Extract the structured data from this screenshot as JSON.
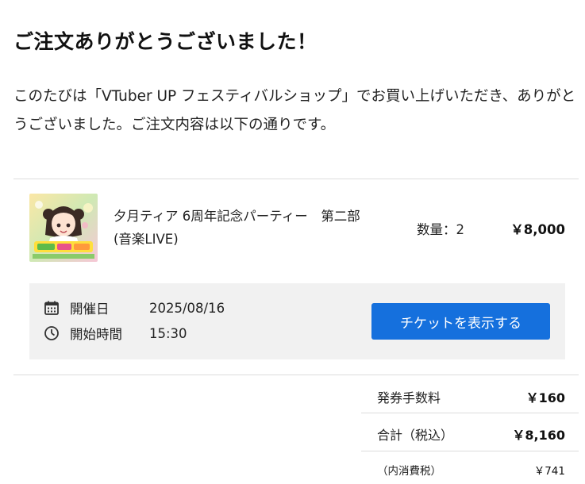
{
  "page": {
    "title": "ご注文ありがとうございました！",
    "intro": "このたびは「VTuber UP フェスティバルショップ」でお買い上げいただき、ありがとうございました。ご注文内容は以下の通りです。"
  },
  "order_item": {
    "name": "夕月ティア 6周年記念パーティー　第二部(音楽LIVE)",
    "quantity": "数量：2",
    "price": "￥8,000",
    "event": {
      "date_label": "開催日",
      "date_value": "2025/08/16",
      "time_label": "開始時間",
      "time_value": "15:30",
      "ticket_button": "チケットを表示する"
    }
  },
  "summary": {
    "fee_label": "発券手数料",
    "fee_value": "￥160",
    "total_label": "合計（税込）",
    "total_value": "￥8,160",
    "tax_label": "（内消費税）",
    "tax_value": "￥741"
  },
  "colors": {
    "button": "#1570dd",
    "event_box": "#f1f1f1",
    "divider": "#dcdcdc"
  },
  "icons": {
    "date": "calendar-icon",
    "time": "clock-icon"
  }
}
